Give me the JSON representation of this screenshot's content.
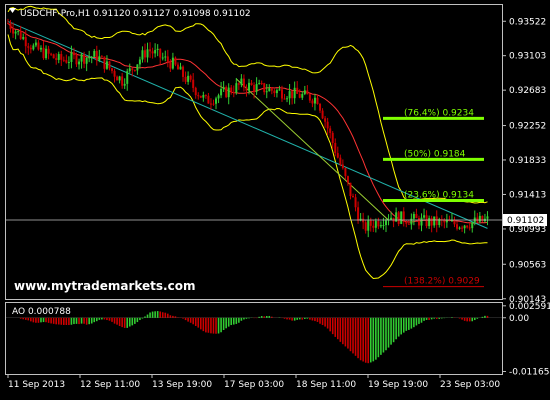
{
  "chart_data": {
    "type": "candlestick",
    "symbol_header": "USDCHF-Pro,H1  0.91120 0.91127 0.91098 0.91102",
    "watermark": "www.mytrademarkets.com",
    "price_axis": [
      "0.93522",
      "0.93103",
      "0.92683",
      "0.92252",
      "0.91833",
      "0.91413",
      "0.90993",
      "0.90563",
      "0.90143"
    ],
    "current_price": "0.91102",
    "time_axis": [
      "11 Sep 2013",
      "12 Sep 11:00",
      "13 Sep 19:00",
      "17 Sep 03:00",
      "18 Sep 11:00",
      "19 Sep 19:00",
      "23 Sep 03:00"
    ],
    "ylim": [
      0.9014,
      0.9372
    ],
    "fib_levels": [
      {
        "label": "(76.4%) 0.9234",
        "price": 0.9234,
        "color": "#7fff00"
      },
      {
        "label": "(50%) 0.9184",
        "price": 0.9184,
        "color": "#7fff00"
      },
      {
        "label": "(23.6%) 0.9134",
        "price": 0.9134,
        "color": "#7fff00"
      },
      {
        "label": "(138.2%) 0.9029",
        "price": 0.9029,
        "color": "#cc0000"
      }
    ],
    "ao_indicator": {
      "label": "AO 0.000788",
      "axis": [
        "0.002591",
        "0.00",
        "-0.011654"
      ],
      "ylim": [
        -0.0122,
        0.0032
      ]
    },
    "colors": {
      "bull": "#32cd32",
      "bear": "#cc0000",
      "bands": "#ffff00",
      "trend": "#20b2aa",
      "grid": "#c0c0c0"
    }
  }
}
